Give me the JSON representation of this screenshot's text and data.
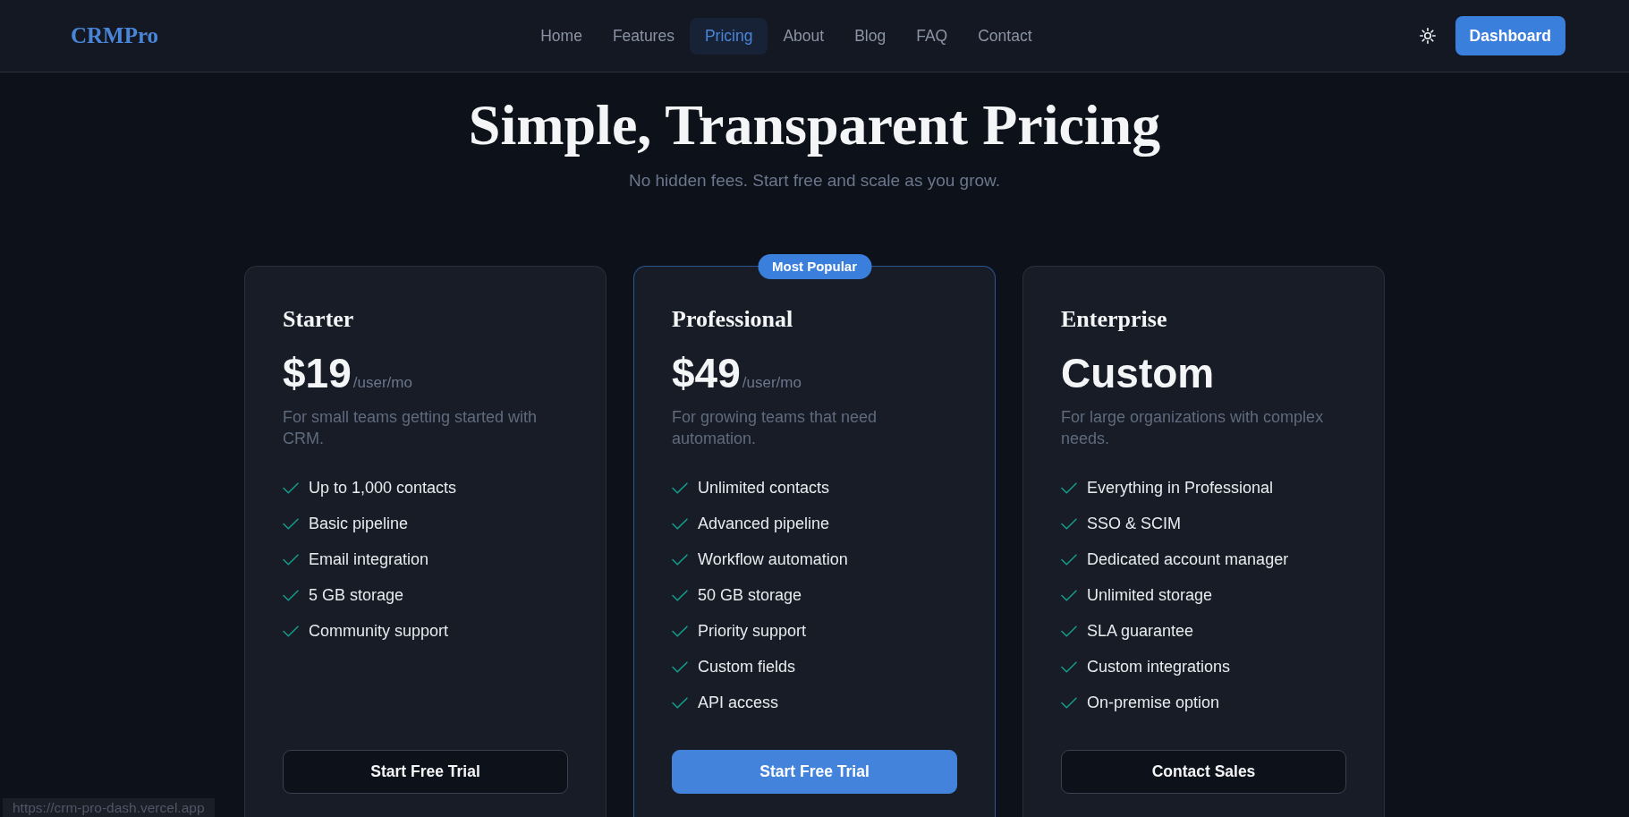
{
  "navbar": {
    "logo": "CRMPro",
    "links": [
      {
        "label": "Home",
        "selected": false
      },
      {
        "label": "Features",
        "selected": false
      },
      {
        "label": "Pricing",
        "selected": true
      },
      {
        "label": "About",
        "selected": false
      },
      {
        "label": "Blog",
        "selected": false
      },
      {
        "label": "FAQ",
        "selected": false
      },
      {
        "label": "Contact",
        "selected": false
      }
    ],
    "dashboard_button": "Dashboard"
  },
  "header": {
    "title": "Simple, Transparent Pricing",
    "subtitle": "No hidden fees. Start free and scale as you grow."
  },
  "plans": [
    {
      "name": "Starter",
      "featured": false,
      "price": "$19",
      "period": "/user/mo",
      "description": "For small teams getting started with CRM.",
      "features": [
        "Up to 1,000 contacts",
        "Basic pipeline",
        "Email integration",
        "5 GB storage",
        "Community support"
      ],
      "button": "Start Free Trial"
    },
    {
      "badge": "Most Popular",
      "name": "Professional",
      "featured": true,
      "price": "$49",
      "period": "/user/mo",
      "description": "For growing teams that need automation.",
      "features": [
        "Unlimited contacts",
        "Advanced pipeline",
        "Workflow automation",
        "50 GB storage",
        "Priority support",
        "Custom fields",
        "API access"
      ],
      "button": "Start Free Trial"
    },
    {
      "name": "Enterprise",
      "featured": false,
      "price": "Custom",
      "description": "For large organizations with complex needs.",
      "features": [
        "Everything in Professional",
        "SSO & SCIM",
        "Dedicated account manager",
        "Unlimited storage",
        "SLA guarantee",
        "Custom integrations",
        "On-premise option"
      ],
      "button": "Contact Sales"
    }
  ],
  "status_bar": {
    "url": "https://crm-pro-dash.vercel.app"
  }
}
